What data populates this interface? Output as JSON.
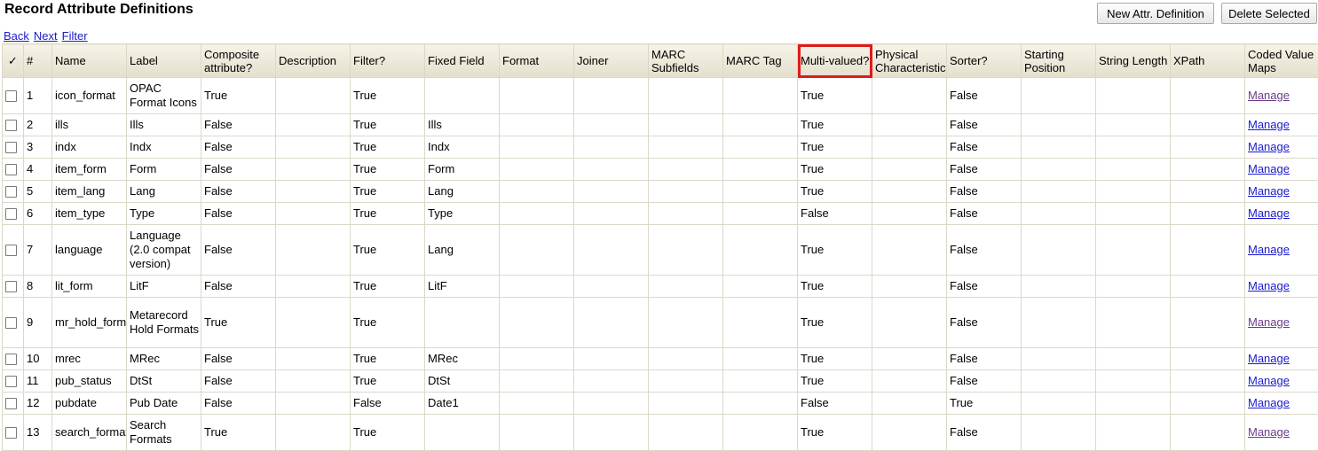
{
  "page": {
    "title": "Record Attribute Definitions"
  },
  "toolbar": {
    "new_label": "New Attr. Definition",
    "delete_label": "Delete Selected"
  },
  "nav": {
    "back": "Back",
    "next": "Next",
    "filter": "Filter"
  },
  "columns": {
    "check": "✓",
    "num": "#",
    "name": "Name",
    "label": "Label",
    "composite": "Composite attribute?",
    "description": "Description",
    "filter": "Filter?",
    "fixed_field": "Fixed Field",
    "format": "Format",
    "joiner": "Joiner",
    "marc_subfields": "MARC Subfields",
    "marc_tag": "MARC Tag",
    "multi_valued": "Multi-valued?",
    "physical": "Physical Characteristic",
    "sorter": "Sorter?",
    "starting_position": "Starting Position",
    "string_length": "String Length",
    "xpath": "XPath",
    "coded_value_maps": "Coded Value Maps"
  },
  "rows": [
    {
      "num": "1",
      "name": "icon_format",
      "label": "OPAC Format Icons",
      "composite": "True",
      "filter": "True",
      "fixed": "",
      "multi": "True",
      "sorter": "False",
      "link": "Manage"
    },
    {
      "num": "2",
      "name": "ills",
      "label": "Ills",
      "composite": "False",
      "filter": "True",
      "fixed": "Ills",
      "multi": "True",
      "sorter": "False",
      "link": "Manage"
    },
    {
      "num": "3",
      "name": "indx",
      "label": "Indx",
      "composite": "False",
      "filter": "True",
      "fixed": "Indx",
      "multi": "True",
      "sorter": "False",
      "link": "Manage"
    },
    {
      "num": "4",
      "name": "item_form",
      "label": "Form",
      "composite": "False",
      "filter": "True",
      "fixed": "Form",
      "multi": "True",
      "sorter": "False",
      "link": "Manage"
    },
    {
      "num": "5",
      "name": "item_lang",
      "label": "Lang",
      "composite": "False",
      "filter": "True",
      "fixed": "Lang",
      "multi": "True",
      "sorter": "False",
      "link": "Manage"
    },
    {
      "num": "6",
      "name": "item_type",
      "label": "Type",
      "composite": "False",
      "filter": "True",
      "fixed": "Type",
      "multi": "False",
      "sorter": "False",
      "link": "Manage"
    },
    {
      "num": "7",
      "name": "language",
      "label": "Language (2.0 compat version)",
      "composite": "False",
      "filter": "True",
      "fixed": "Lang",
      "multi": "True",
      "sorter": "False",
      "link": "Manage"
    },
    {
      "num": "8",
      "name": "lit_form",
      "label": "LitF",
      "composite": "False",
      "filter": "True",
      "fixed": "LitF",
      "multi": "True",
      "sorter": "False",
      "link": "Manage"
    },
    {
      "num": "9",
      "name": "mr_hold_format",
      "label": "Metarecord Hold Formats",
      "composite": "True",
      "filter": "True",
      "fixed": "",
      "multi": "True",
      "sorter": "False",
      "link": "Manage"
    },
    {
      "num": "10",
      "name": "mrec",
      "label": "MRec",
      "composite": "False",
      "filter": "True",
      "fixed": "MRec",
      "multi": "True",
      "sorter": "False",
      "link": "Manage"
    },
    {
      "num": "11",
      "name": "pub_status",
      "label": "DtSt",
      "composite": "False",
      "filter": "True",
      "fixed": "DtSt",
      "multi": "True",
      "sorter": "False",
      "link": "Manage"
    },
    {
      "num": "12",
      "name": "pubdate",
      "label": "Pub Date",
      "composite": "False",
      "filter": "False",
      "fixed": "Date1",
      "multi": "False",
      "sorter": "True",
      "link": "Manage"
    },
    {
      "num": "13",
      "name": "search_format",
      "label": "Search Formats",
      "composite": "True",
      "filter": "True",
      "fixed": "",
      "multi": "True",
      "sorter": "False",
      "link": "Manage"
    }
  ]
}
